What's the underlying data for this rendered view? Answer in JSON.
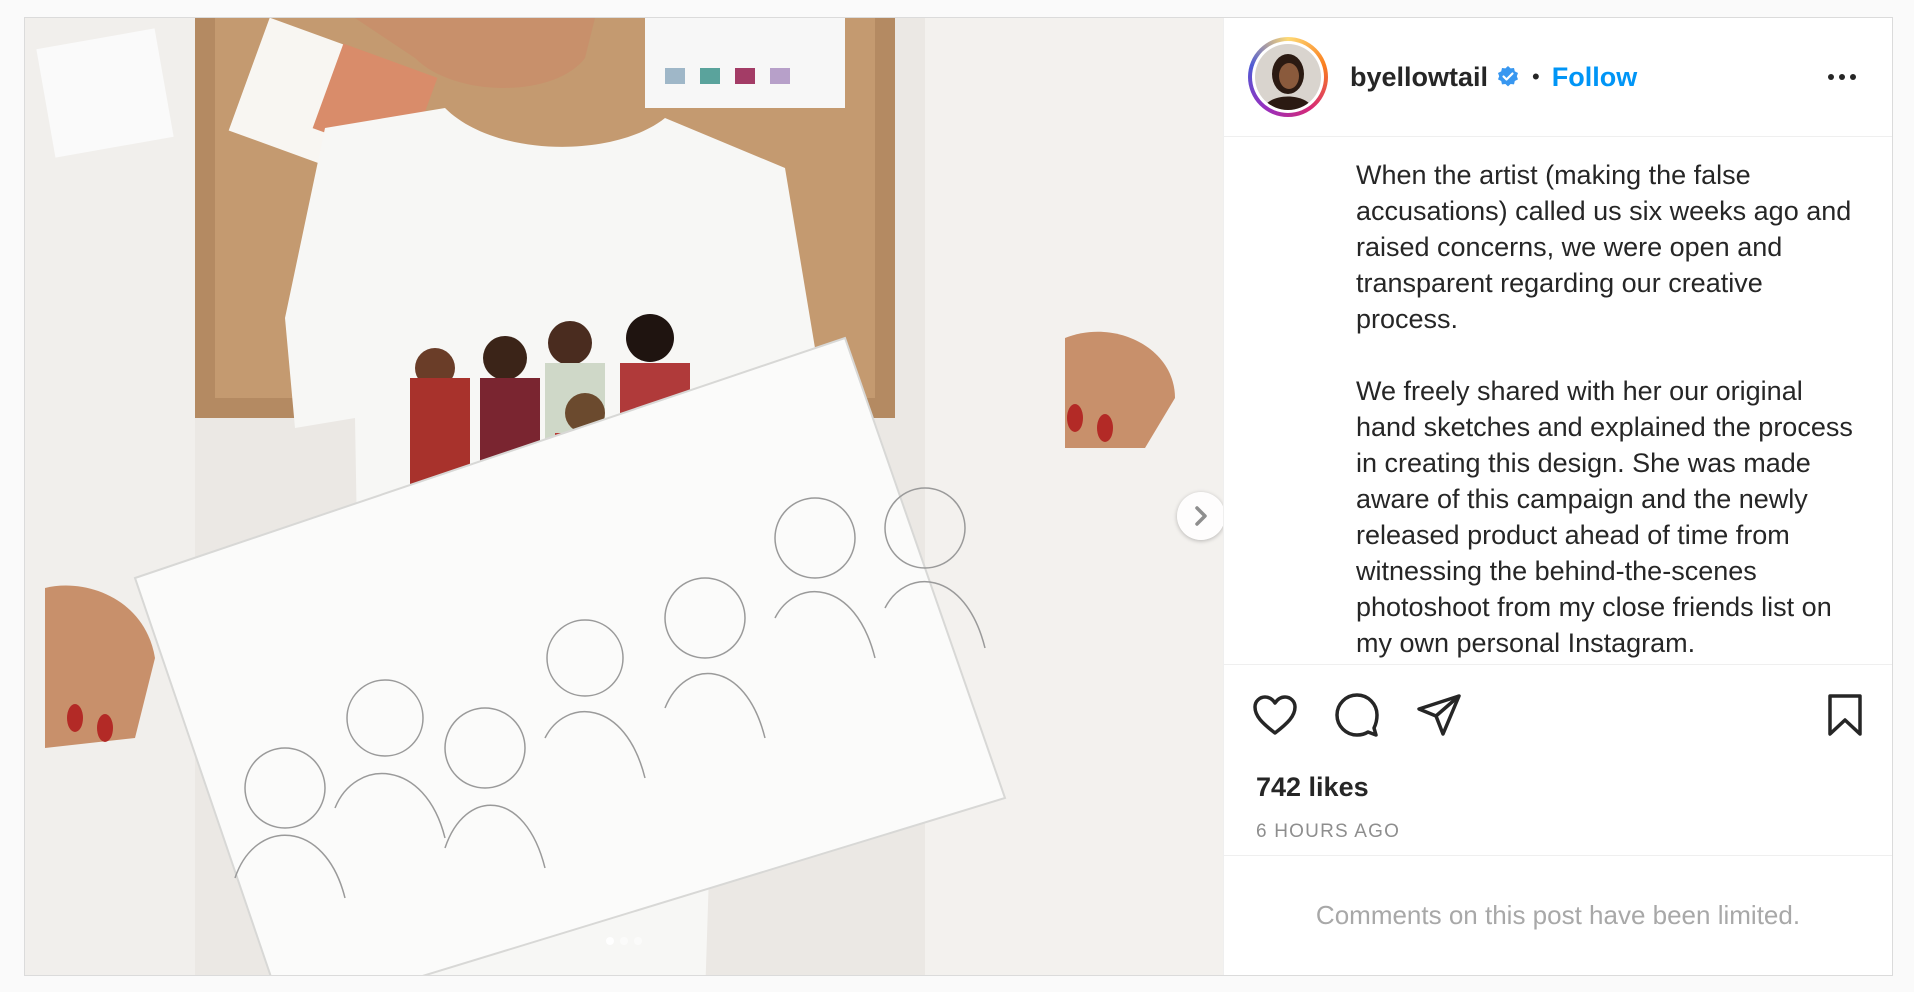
{
  "post": {
    "username": "byellowtail",
    "separator": "•",
    "follow_label": "Follow",
    "caption_paragraphs": [
      "When the artist (making the false accusations) called us six weeks ago and raised concerns, we were open and transparent regarding our creative process.",
      "We freely shared with her our original hand sketches and explained the process in creating this design. She was made aware of this campaign and the newly released product ahead of time from witnessing the behind-the-scenes photoshoot from my close friends list on my own personal Instagram."
    ],
    "likes": "742 likes",
    "timestamp": "6 HOURS AGO",
    "comments_notice": "Comments on this post have been limited."
  },
  "colors": {
    "link": "#0095f6",
    "text": "#262626",
    "muted": "#8e8e8e",
    "verified": "#3897f0"
  },
  "icons": {
    "verified": "verified-badge-icon",
    "more": "more-options-icon",
    "like": "heart-icon",
    "comment": "comment-icon",
    "share": "share-icon",
    "save": "bookmark-icon",
    "next": "chevron-right-icon"
  },
  "carousel": {
    "total": 3,
    "active": 1
  }
}
